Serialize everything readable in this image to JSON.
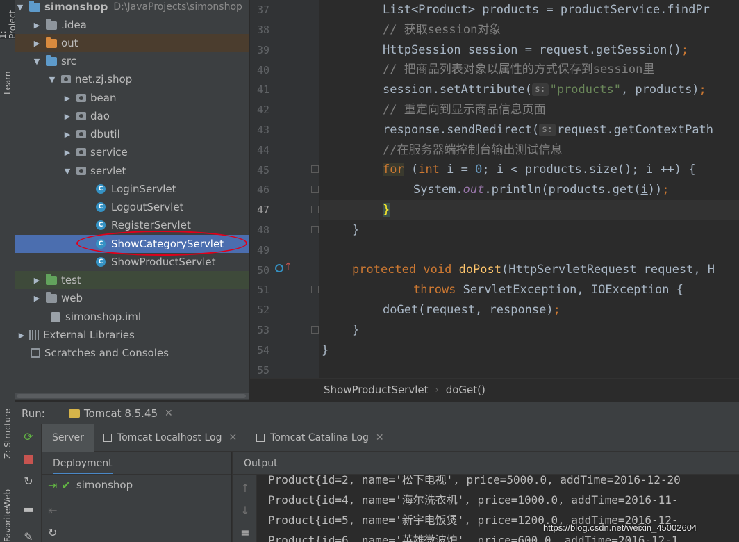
{
  "left_strip": {
    "tabs": [
      "1: Project",
      "Learn",
      "Z: Structure",
      "Web",
      "Favorites"
    ]
  },
  "project": {
    "root": {
      "label": "simonshop",
      "path": "D:\\JavaProjects\\simonshop"
    },
    "items": [
      {
        "label": ".idea"
      },
      {
        "label": "out"
      },
      {
        "label": "src"
      },
      {
        "label": "net.zj.shop"
      },
      {
        "label": "bean"
      },
      {
        "label": "dao"
      },
      {
        "label": "dbutil"
      },
      {
        "label": "service"
      },
      {
        "label": "servlet"
      },
      {
        "label": "LoginServlet"
      },
      {
        "label": "LogoutServlet"
      },
      {
        "label": "RegisterServlet"
      },
      {
        "label": "ShowCategoryServlet"
      },
      {
        "label": "ShowProductServlet"
      },
      {
        "label": "test"
      },
      {
        "label": "web"
      },
      {
        "label": "simonshop.iml"
      },
      {
        "label": "External Libraries"
      },
      {
        "label": "Scratches and Consoles"
      }
    ]
  },
  "editor": {
    "line_numbers": [
      "37",
      "38",
      "39",
      "40",
      "41",
      "42",
      "43",
      "44",
      "45",
      "46",
      "47",
      "48",
      "49",
      "50",
      "51",
      "52",
      "53",
      "54",
      "55"
    ],
    "current_line": "47",
    "hint_s": "s:",
    "lines": {
      "l37a": "List<Product> products = productService.findPr",
      "l38": "// 获取session对象",
      "l39a": "HttpSession session = request.getSession()",
      "l39b": ";",
      "l40": "// 把商品列表对象以属性的方式保存到session里",
      "l41a": "session.setAttribute(",
      "l41b": "\"products\"",
      "l41c": ", products)",
      "l41d": ";",
      "l42": "// 重定向到显示商品信息页面",
      "l43a": "response.sendRedirect(",
      "l43b": "request.getContextPath",
      "l44": "//在服务器端控制台输出测试信息",
      "l45_for": "for",
      "l45_b": " (",
      "l45_int": "int",
      "l45_i1": "i",
      "l45_c": " = ",
      "l45_zero": "0",
      "l45_d": "; ",
      "l45_i2": "i",
      "l45_e": " < products.size(); ",
      "l45_i3": "i",
      "l45_f": " ++) {",
      "l46a": "System.",
      "l46_out": "out",
      "l46b": ".println(products.get(",
      "l46_i": "i",
      "l46c": "))",
      "l46d": ";",
      "l47": "}",
      "l48": "}",
      "l50_prot": "protected",
      "l50_void": "void",
      "l50_fn": "doPost",
      "l50_rest": "(HttpServletRequest request, H",
      "l51_throws": "throws",
      "l51_rest": " ServletException, IOException {",
      "l52a": "doGet(request, response)",
      "l52b": ";",
      "l53": "}",
      "l54": "}"
    }
  },
  "breadcrumb": {
    "file": "ShowProductServlet",
    "method": "doGet()"
  },
  "run": {
    "label": "Run:",
    "config": "Tomcat 8.5.45",
    "tabs": [
      "Server",
      "Tomcat Localhost Log",
      "Tomcat Catalina Log"
    ],
    "deployment_header": "Deployment",
    "output_header": "Output",
    "deployment_item": "simonshop",
    "output_lines": [
      "Product{id=2, name='松下电视', price=5000.0, addTime=2016-12-20",
      "Product{id=4, name='海尔洗衣机', price=1000.0, addTime=2016-11-",
      "Product{id=5, name='新宇电饭煲', price=1200.0, addTime=2016-12-",
      "Product{id=6, name='英雄微波炉', price=600.0, addTime=2016-12-1"
    ]
  },
  "watermark": "https://blog.csdn.net/weixin_45002604",
  "colors": {
    "selection": "#4b6eaf",
    "annotation_circle": "#e0001b",
    "keyword": "#cc7832",
    "string": "#6a8759"
  }
}
